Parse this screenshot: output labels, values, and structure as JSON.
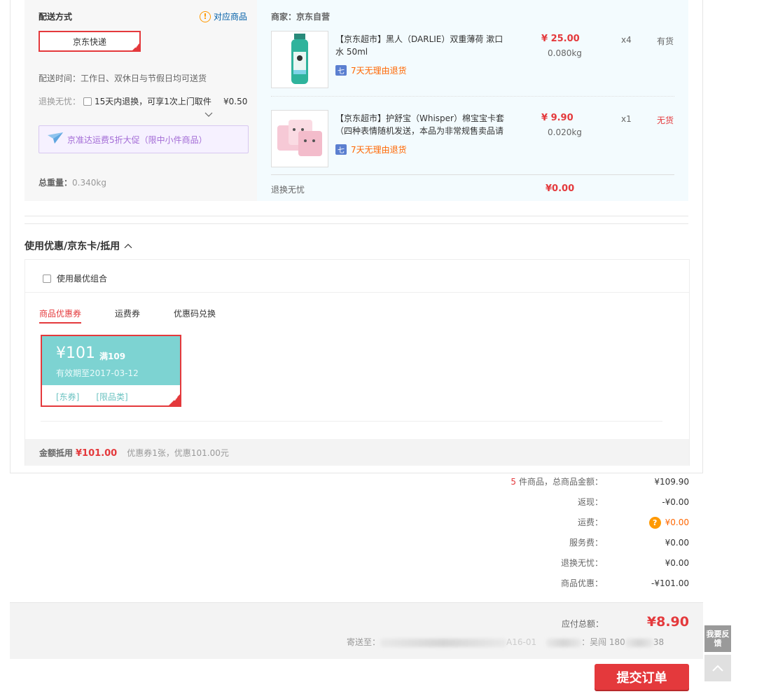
{
  "shipping": {
    "title": "配送方式",
    "match_link": "对应商品",
    "method": "京东快递",
    "time_label": "配送时间：",
    "time_value": "工作日、双休日与节假日均可送货",
    "return_label": "退换无忧：",
    "return_option": "15天内退换，可享1次上门取件",
    "return_fee": "¥0.50",
    "promo": "京准达运费5折大促（限中小件商品）",
    "weight_label": "总重量：",
    "weight_value": "0.340kg"
  },
  "seller": {
    "label": "商家：京东自营"
  },
  "items": [
    {
      "name": "【京东超市】黑人（DARLIE）双重薄荷 漱口水 50ml",
      "tag": "7天无理由退货",
      "price": "¥ 25.00",
      "weight": "0.080kg",
      "qty": "x4",
      "stock": "有货"
    },
    {
      "name": "【京东超市】护舒宝（Whisper）棉宝宝卡套（四种表情随机发送，本品为非常规售卖品请",
      "tag": "7天无理由退货",
      "price": "¥ 9.90",
      "weight": "0.020kg",
      "qty": "x1",
      "stock": "无货"
    }
  ],
  "return_service": {
    "label": "退换无忧",
    "value": "¥0.00"
  },
  "coupons": {
    "heading": "使用优惠/京东卡/抵用",
    "best_combo": "使用最优组合",
    "tabs": [
      "商品优惠券",
      "运费券",
      "优惠码兑换"
    ],
    "card": {
      "amount": "¥101",
      "condition": "满109",
      "expiry": "有效期至2017-03-12",
      "tag1": "[东券]",
      "tag2": "[限品类]"
    },
    "deduct_label": "金额抵用",
    "deduct_value": "¥101.00",
    "deduct_info": "优惠券1张，优惠101.00元"
  },
  "summary": {
    "count": "5",
    "goods_label": "件商品，总商品金额：",
    "goods_value": "¥109.90",
    "cashback_label": "返现：",
    "cashback_value": "-¥0.00",
    "freight_label": "运费：",
    "freight_value": "¥0.00",
    "service_label": "服务费：",
    "service_value": "¥0.00",
    "return_label": "退换无忧：",
    "return_value": "¥0.00",
    "discount_label": "商品优惠：",
    "discount_value": "-¥101.00"
  },
  "payment": {
    "total_label": "应付总额：",
    "total_value": "¥8.90",
    "ship_to_label": "寄送至：",
    "ship_to_mid": "A16-01",
    "receiver_label": "：吴闯 180",
    "receiver_tail": "38"
  },
  "actions": {
    "submit": "提交订单",
    "feedback": "我要反馈"
  },
  "colors": {
    "accent": "#e4393c",
    "coupon": "#7dd3d2",
    "orange": "#ff6600"
  }
}
